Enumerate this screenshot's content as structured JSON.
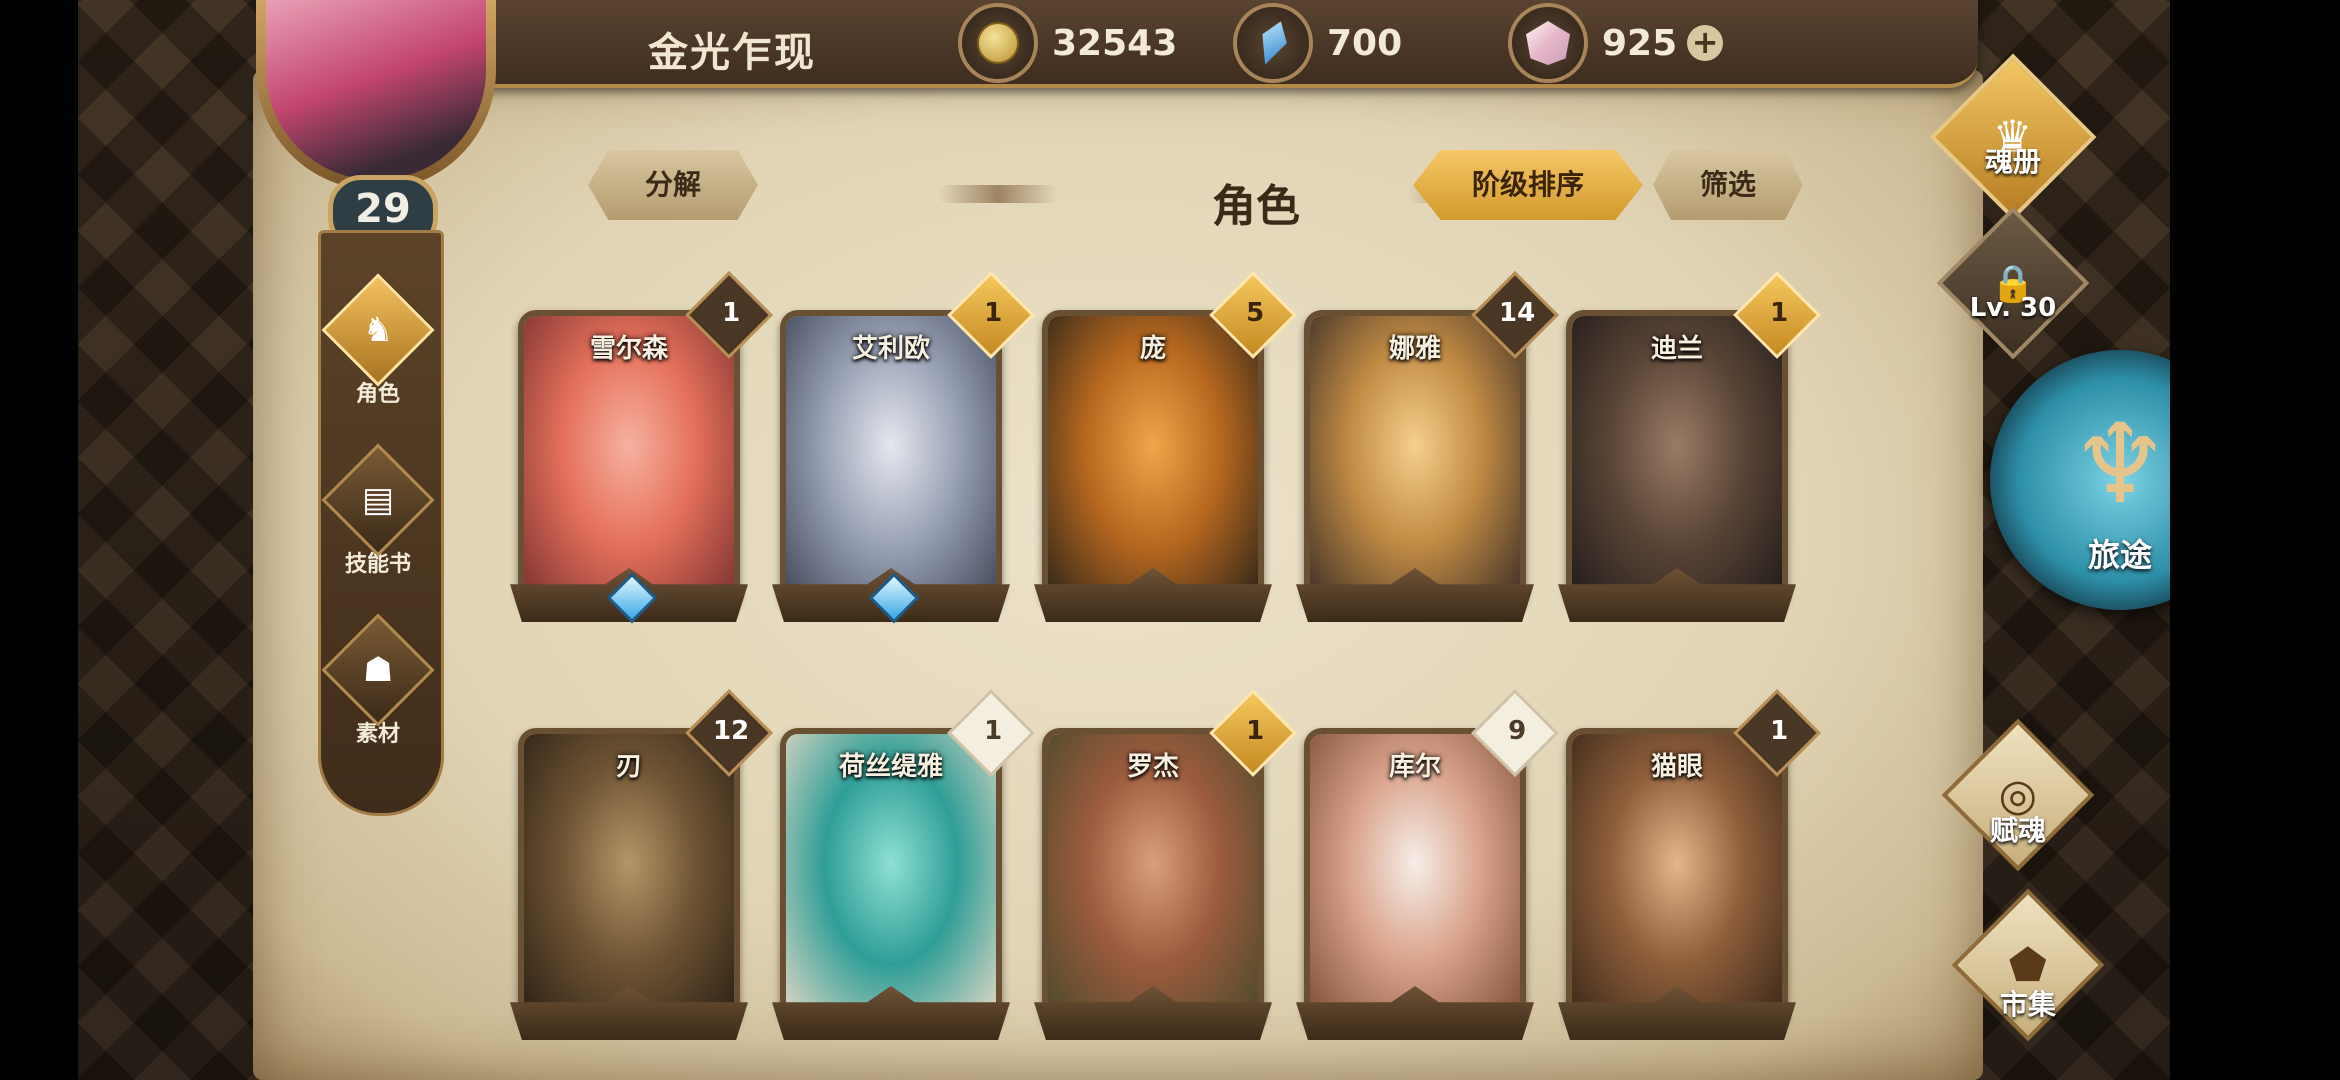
{
  "header": {
    "stage_name": "金光乍现",
    "gold": "32543",
    "blue_gems": "700",
    "crystals": "925",
    "plus_glyph": "+",
    "player_level": "29"
  },
  "leftnav": {
    "items": [
      {
        "label": "角色",
        "icon": "helmet-icon",
        "active": true
      },
      {
        "label": "技能书",
        "icon": "skill-book-icon",
        "active": false
      },
      {
        "label": "素材",
        "icon": "beast-face-icon",
        "active": false
      }
    ]
  },
  "toolbar": {
    "decompose": "分解",
    "title": "角色",
    "sort": "阶级排序",
    "filter": "筛选"
  },
  "cards": [
    {
      "name": "雪尔森",
      "count": "1",
      "badge": "dark",
      "gem": true,
      "colors": [
        "#f7b1a0",
        "#e4705a",
        "#7a3030"
      ]
    },
    {
      "name": "艾利欧",
      "count": "1",
      "badge": "gold",
      "gem": true,
      "colors": [
        "#e6e7ee",
        "#9aa2b6",
        "#3f4657"
      ]
    },
    {
      "name": "庞",
      "count": "5",
      "badge": "gold",
      "gem": false,
      "colors": [
        "#f2a54a",
        "#b8681f",
        "#2b2418"
      ]
    },
    {
      "name": "娜雅",
      "count": "14",
      "badge": "dark",
      "gem": false,
      "colors": [
        "#f5d08c",
        "#c08a44",
        "#3b2e26"
      ]
    },
    {
      "name": "迪兰",
      "count": "1",
      "badge": "gold",
      "gem": false,
      "colors": [
        "#9a7c66",
        "#5a4536",
        "#201a1a"
      ]
    },
    {
      "name": "刃",
      "count": "12",
      "badge": "dark",
      "gem": false,
      "colors": [
        "#b59668",
        "#6f5434",
        "#2b2014"
      ]
    },
    {
      "name": "荷丝缇雅",
      "count": "1",
      "badge": "light",
      "gem": false,
      "colors": [
        "#8fe0d3",
        "#2f9e97",
        "#e5d9c6"
      ]
    },
    {
      "name": "罗杰",
      "count": "1",
      "badge": "gold",
      "gem": false,
      "colors": [
        "#d9a07b",
        "#9c5b3e",
        "#4a4a2a"
      ]
    },
    {
      "name": "库尔",
      "count": "9",
      "badge": "light",
      "gem": false,
      "colors": [
        "#f6eee8",
        "#d9a28a",
        "#7d4c36"
      ]
    },
    {
      "name": "猫眼",
      "count": "1",
      "badge": "dark",
      "gem": false,
      "colors": [
        "#e6b58a",
        "#8e5e3a",
        "#3a2819"
      ]
    }
  ],
  "rightnav": {
    "soul_book": "魂册",
    "locked_level": "Lv. 30",
    "journey": "旅途",
    "endow_soul": "赋魂",
    "market": "市集"
  },
  "colors": {
    "accent_gold": "#f5c765",
    "parchment": "#e2d5b6",
    "frame_brown": "#6a5033"
  }
}
